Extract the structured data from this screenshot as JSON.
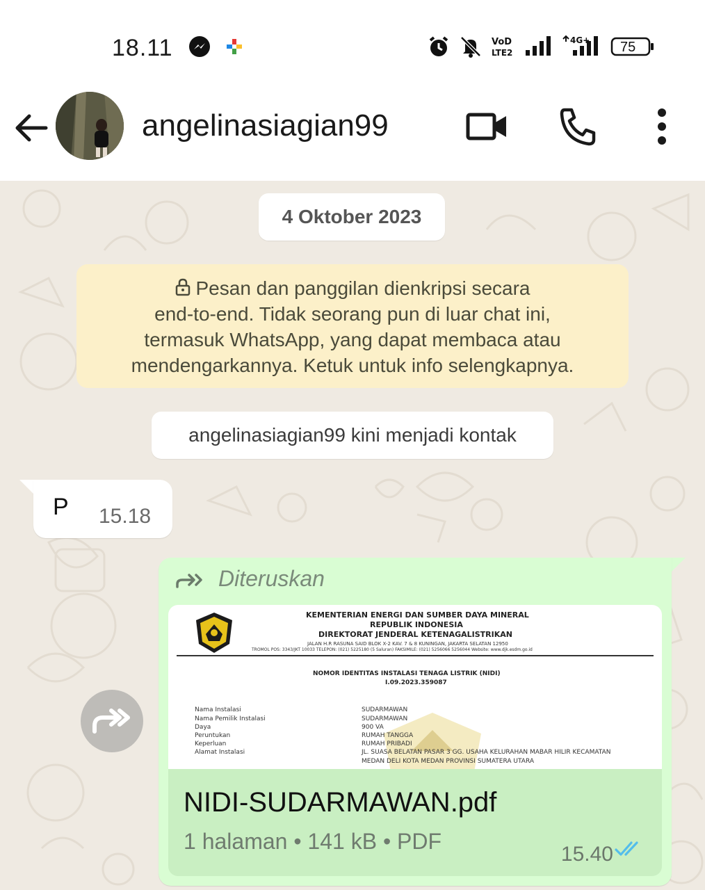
{
  "status_bar": {
    "time": "18.11",
    "battery": "75",
    "network_label": "4G",
    "volte_label": "VoD LTE2"
  },
  "header": {
    "contact_name": "angelinasiagian99"
  },
  "chat": {
    "date_chip": "4 Oktober 2023",
    "encryption_notice": [
      "Pesan dan panggilan dienkripsi secara",
      "end-to-end. Tidak seorang pun di luar chat ini,",
      "termasuk WhatsApp, yang dapat membaca atau",
      "mendengarkannya. Ketuk untuk info selengkapnya."
    ],
    "contact_notice": "angelinasiagian99 kini menjadi kontak",
    "incoming_message": {
      "text": "P",
      "time": "15.18"
    },
    "outgoing_message": {
      "forwarded_label": "Diteruskan",
      "document": {
        "file_name": "NIDI-SUDARMAWAN.pdf",
        "meta": "1 halaman • 141 kB • PDF",
        "preview": {
          "org_line_1": "KEMENTERIAN ENERGI DAN SUMBER DAYA MINERAL",
          "org_line_2": "REPUBLIK INDONESIA",
          "org_line_3": "DIREKTORAT JENDERAL KETENAGALISTRIKAN",
          "address_1": "JALAN H.R RASUNA SAID BLOK X-2 KAV. 7 & 8 KUNINGAN, JAKARTA SELATAN 12950",
          "address_2": "TROMOL POS: 3343/JKT 10033 TELEPON: (021) 5225180 (5 Saluran) FAKSIMILE: (021) 5256066 5256044 Website: www.djk.esdm.go.id",
          "doc_title": "NOMOR IDENTITAS INSTALASI TENAGA LISTRIK (NIDI)",
          "doc_number": "I.09.2023.359087",
          "fields": [
            {
              "label": "Nama Instalasi",
              "value": "SUDARMAWAN"
            },
            {
              "label": "Nama Pemilik Instalasi",
              "value": "SUDARMAWAN"
            },
            {
              "label": "Daya",
              "value": "900 VA"
            },
            {
              "label": "Peruntukan",
              "value": "RUMAH TANGGA"
            },
            {
              "label": "Keperluan",
              "value": "RUMAH PRIBADI"
            },
            {
              "label": "Alamat Instalasi",
              "value": "JL. SUASA BELATAN PASAR 3 GG. USAHA KELURAHAN MABAR HILIR KECAMATAN"
            },
            {
              "label": "",
              "value": "MEDAN DELI KOTA MEDAN PROVINSI SUMATERA UTARA"
            }
          ]
        }
      },
      "time": "15.40"
    }
  },
  "colors": {
    "chat_bg": "#efeae2",
    "outgoing_bubble": "#d9fdd3",
    "encryption_bg": "#fcf0c9",
    "read_ticks": "#53bdeb"
  }
}
